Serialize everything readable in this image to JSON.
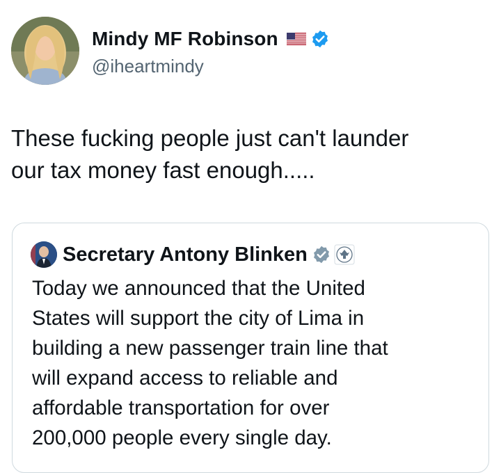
{
  "tweet": {
    "author": {
      "display_name": "Mindy MF Robinson",
      "handle": "@iheartmindy",
      "flag_icon": "us-flag-icon",
      "verified_icon": "verified-badge-icon",
      "verified_color": "#1d9bf0"
    },
    "text_lines": [
      "These fucking people just can't launder",
      "our tax money fast enough....."
    ]
  },
  "quote": {
    "author": {
      "display_name": "Secretary Antony Blinken",
      "verified_icon": "gray-verified-badge-icon",
      "verified_color": "#829aab",
      "affiliate_icon": "state-department-seal-icon"
    },
    "text_lines": [
      "Today we announced that the United",
      "States will support the city of Lima in",
      "building a new passenger train line that",
      "will expand access to reliable and",
      "affordable transportation for over",
      "200,000 people every single day."
    ]
  }
}
